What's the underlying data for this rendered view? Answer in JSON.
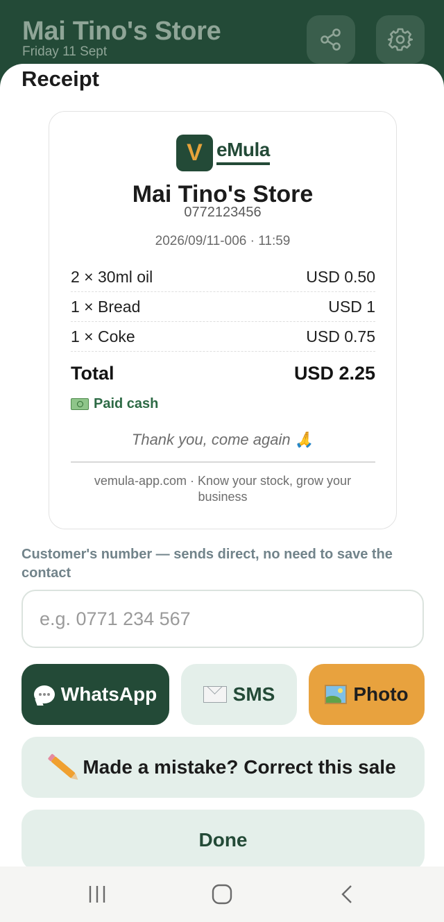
{
  "header": {
    "title": "Mai Tino's Store",
    "date": "Friday 11 Sept",
    "share_icon": "share-icon",
    "settings_icon": "gear-icon"
  },
  "sheet": {
    "title": "Receipt"
  },
  "receipt": {
    "logo_letter": "V",
    "logo_text": "eMula",
    "store_name": "Mai Tino's Store",
    "store_phone": "0772123456",
    "reference": "2026/09/11-006 · 11:59",
    "items": [
      {
        "description": "2 × 30ml oil",
        "price": "USD 0.50"
      },
      {
        "description": "1 × Bread",
        "price": "USD 1"
      },
      {
        "description": "1 × Coke",
        "price": "USD 0.75"
      }
    ],
    "total_label": "Total",
    "total_value": "USD 2.25",
    "payment_icon": "cash-icon",
    "payment_status": "Paid cash",
    "thanks": "Thank you, come again 🙏",
    "footer": "vemula-app.com · Know your stock, grow your business"
  },
  "customer": {
    "label": "Customer's number — sends direct, no need to save the contact",
    "placeholder": "e.g. 0771 234 567",
    "value": ""
  },
  "actions": {
    "whatsapp": "WhatsApp",
    "sms": "SMS",
    "photo": "Photo",
    "correct": "Made a mistake? Correct this sale",
    "done": "Done"
  },
  "colors": {
    "brand_green": "#234a37",
    "accent_orange": "#e8a23e",
    "soft_green": "#e4efea",
    "paid_green": "#2d6a45"
  }
}
